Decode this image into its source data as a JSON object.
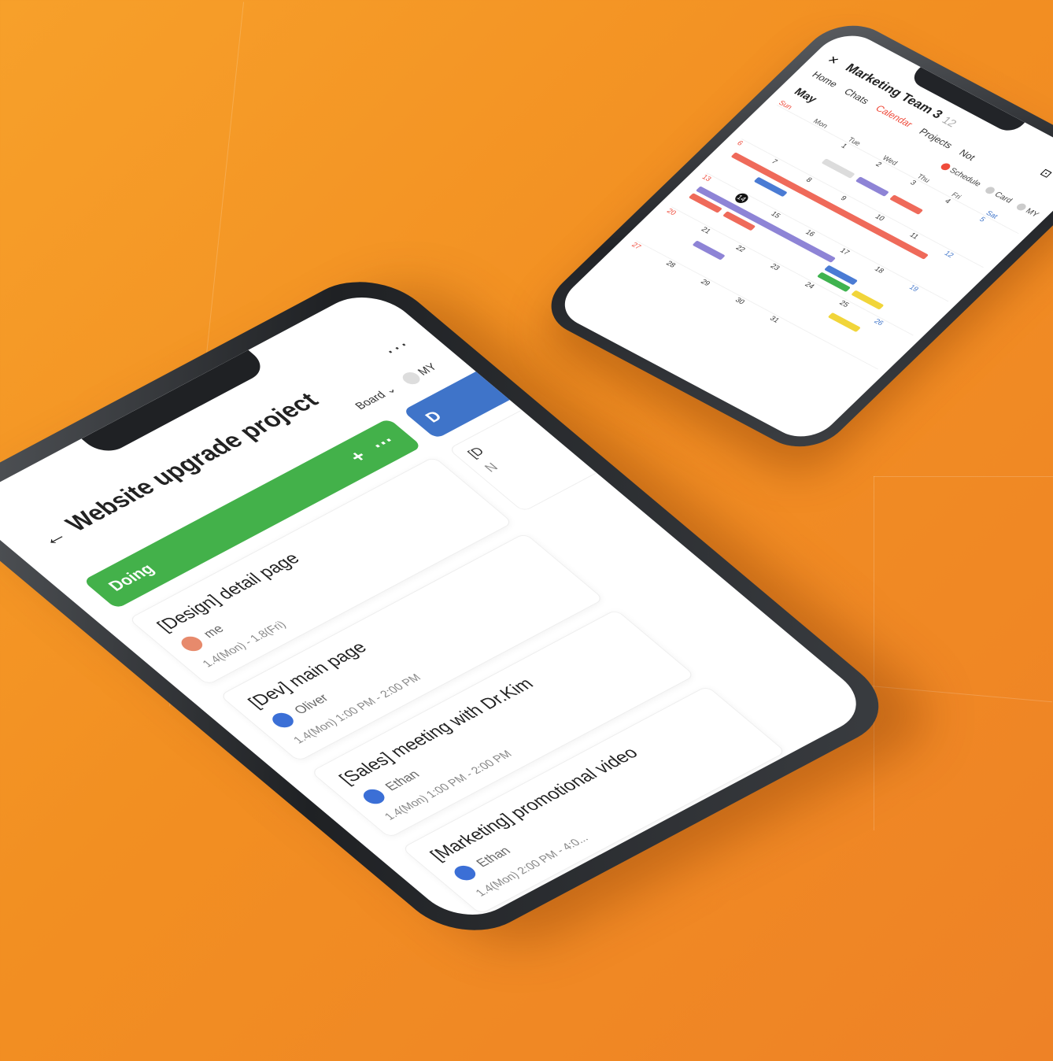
{
  "board": {
    "title": "Website upgrade project",
    "back_icon": "←",
    "more_icon": "···",
    "view_label": "Board",
    "my_label": "MY",
    "column": {
      "name": "Doing",
      "add_icon": "+",
      "menu_icon": "···"
    },
    "cards": [
      {
        "title": "[Design] detail page",
        "user": "me",
        "date": "1.4(Mon) - 1.8(Fri)"
      },
      {
        "title": "[Dev] main page",
        "user": "Oliver",
        "date": "1.4(Mon) 1:00 PM - 2:00 PM"
      },
      {
        "title": "[Sales] meeting with Dr.Kim",
        "user": "Ethan",
        "date": "1.4(Mon) 1:00 PM - 2:00 PM"
      },
      {
        "title": "[Marketing] promotional video",
        "user": "Ethan",
        "date": "1.4(Mon) 2:00 PM - 4:0..."
      }
    ],
    "next_column": {
      "name": "D",
      "card_title": "[D",
      "card_meta": "N"
    }
  },
  "calendar": {
    "close_icon": "×",
    "team_name": "Marketing Team 3",
    "member_count": "12",
    "tabs": [
      "Home",
      "Chats",
      "Calendar",
      "Projects",
      "Not"
    ],
    "active_tab": "Calendar",
    "month": "May",
    "filters": [
      "Schedule",
      "Card",
      "MY"
    ],
    "weekdays": [
      "Sun",
      "Mon",
      "Tue",
      "Wed",
      "Thu",
      "Fri",
      "Sat"
    ],
    "weeks": [
      [
        "",
        "",
        "1",
        "2",
        "3",
        "4",
        "5"
      ],
      [
        "6",
        "7",
        "8",
        "9",
        "10",
        "11",
        "12"
      ],
      [
        "13",
        "14",
        "15",
        "16",
        "17",
        "18",
        "19"
      ],
      [
        "20",
        "21",
        "22",
        "23",
        "24",
        "25",
        "26"
      ],
      [
        "27",
        "28",
        "29",
        "30",
        "31",
        "",
        ""
      ]
    ],
    "today": "14",
    "colors": {
      "red": "#ef6a5a",
      "purple": "#8e84d6",
      "blue": "#4a7bd4",
      "green": "#3fb34f",
      "yellow": "#f1d53a"
    }
  }
}
